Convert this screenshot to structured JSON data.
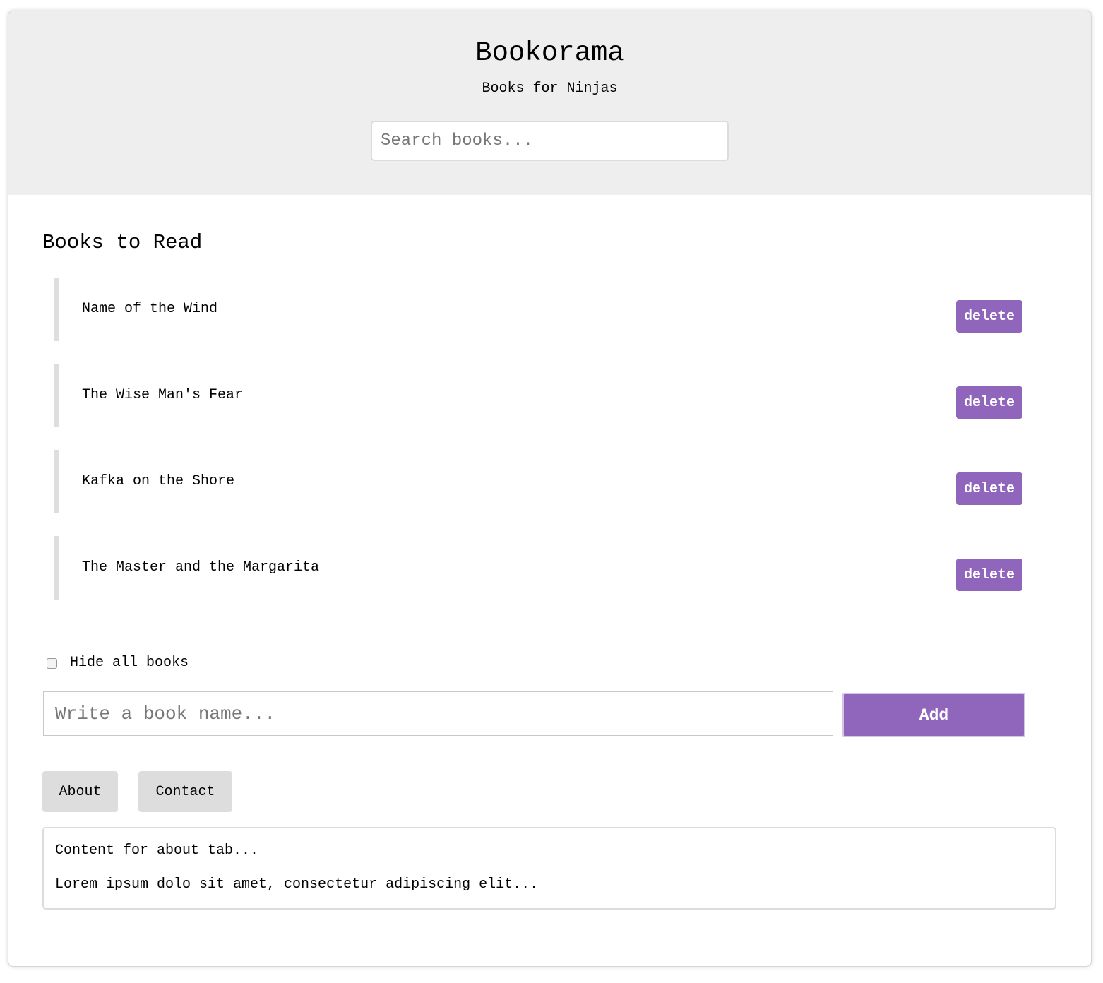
{
  "header": {
    "title": "Bookorama",
    "subtitle": "Books for Ninjas",
    "search_placeholder": "Search books..."
  },
  "books_section": {
    "title": "Books to Read",
    "books": [
      {
        "name": "Name of the Wind",
        "delete_label": "delete"
      },
      {
        "name": "The Wise Man's Fear",
        "delete_label": "delete"
      },
      {
        "name": "Kafka on the Shore",
        "delete_label": "delete"
      },
      {
        "name": "The Master and the Margarita",
        "delete_label": "delete"
      }
    ]
  },
  "hide_books": {
    "label": "Hide all books",
    "checked": false
  },
  "add_form": {
    "placeholder": "Write a book name...",
    "button_label": "Add"
  },
  "tabs": [
    {
      "label": "About"
    },
    {
      "label": "Contact"
    }
  ],
  "tab_panel": {
    "line1": "Content for about tab...",
    "line2": "Lorem ipsum dolo sit amet, consectetur adipiscing elit..."
  },
  "colors": {
    "accent": "#8f66bc",
    "header_bg": "#eeeeee",
    "tab_bg": "#dddddd"
  }
}
